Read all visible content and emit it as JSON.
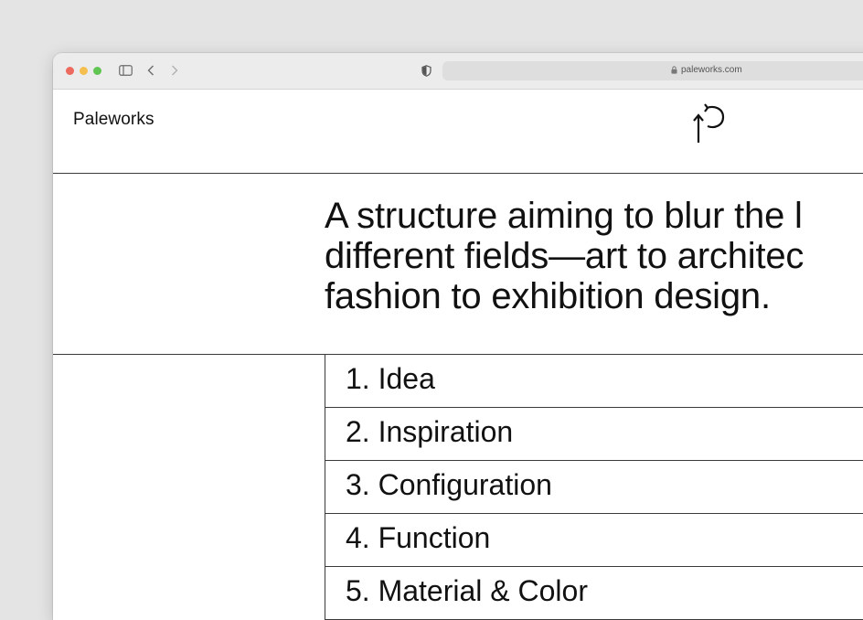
{
  "browser": {
    "url": "paleworks.com",
    "icons": {
      "sidebar": "sidebar-icon",
      "back": "chevron-left-icon",
      "forward": "chevron-right-icon",
      "shield": "shield-icon",
      "lock": "lock-icon"
    }
  },
  "site": {
    "brand": "Paleworks",
    "logo_icon": "arrow-p-logo",
    "headline": "A structure aiming to blur the l\ndifferent fields—art to architec\nfashion to exhibition design.",
    "list": [
      "1. Idea",
      "2. Inspiration",
      "3. Configuration",
      "4. Function",
      "5. Material & Color"
    ]
  },
  "colors": {
    "background": "#e4e4e4",
    "toolbar": "#ececec",
    "text": "#111111",
    "lines": "#3a3a3a"
  }
}
